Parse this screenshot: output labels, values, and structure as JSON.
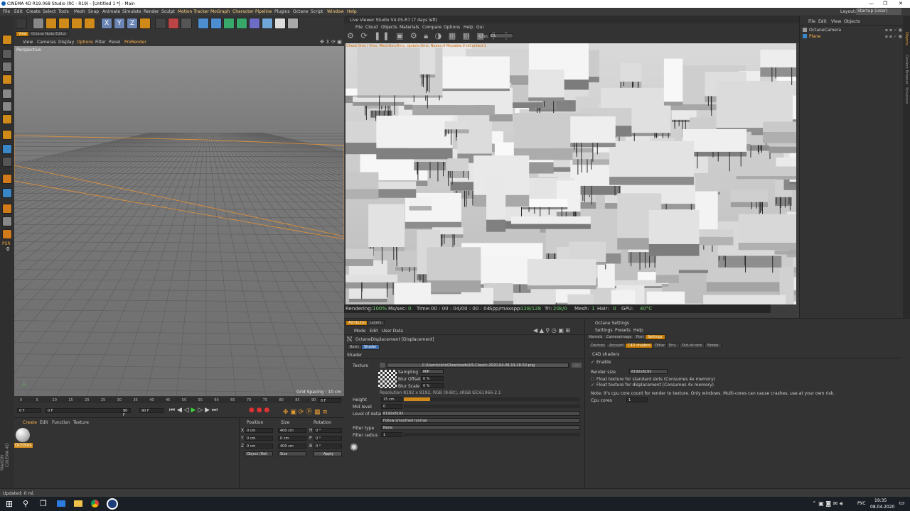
{
  "window": {
    "title": "CINEMA 4D R19.068 Studio (RC - R19) - [Untitled 1 *] - Main",
    "controls": [
      "—",
      "❐",
      "✕"
    ]
  },
  "menubar": {
    "items": [
      "File",
      "Edit",
      "Create",
      "Select",
      "Tools",
      "Mesh",
      "Snap",
      "Animate",
      "Simulate",
      "Render",
      "Sculpt",
      "Motion Tracker",
      "MoGraph",
      "Character",
      "Pipeline",
      "Plugins",
      "Octane",
      "Script",
      "Window",
      "Help"
    ],
    "layout_label": "Layout:",
    "layout_value": "Startup (User)"
  },
  "viewport": {
    "menu": [
      "View",
      "Cameras",
      "Display",
      "Options",
      "Filter",
      "Panel",
      "ProRender"
    ],
    "tab": "Octane Node Editor",
    "label": "Perspective",
    "grid_spacing": "Grid Spacing : 10 cm"
  },
  "timeline": {
    "ticks": [
      "0",
      "5",
      "10",
      "15",
      "20",
      "25",
      "30",
      "35",
      "40",
      "45",
      "50",
      "55",
      "60",
      "65",
      "70",
      "75",
      "80",
      "85",
      "90"
    ],
    "end_frame": "0 F",
    "start_field": "0 F",
    "current_field": "0 F",
    "max_field": "90 F",
    "end_field": "90 F"
  },
  "material_manager": {
    "menu": [
      "Create",
      "Edit",
      "Function",
      "Texture"
    ],
    "material_name": "OctGlos"
  },
  "coordinates": {
    "headers": [
      "Position",
      "Size",
      "Rotation"
    ],
    "rows": [
      {
        "axis": "X",
        "pos": "0 cm",
        "size": "400 cm",
        "rot_axis": "H",
        "rot": "0 °"
      },
      {
        "axis": "Y",
        "pos": "0 cm",
        "size": "0 cm",
        "rot_axis": "P",
        "rot": "0 °"
      },
      {
        "axis": "Z",
        "pos": "0 cm",
        "size": "400 cm",
        "rot_axis": "B",
        "rot": "0 °"
      }
    ],
    "mode": "Object (Rel)",
    "size_mode": "Size",
    "apply": "Apply"
  },
  "live_viewer": {
    "title": "Live Viewer Studio V4.05-R7 (7 days left)",
    "menu": [
      "File",
      "Cloud",
      "Objects",
      "Materials",
      "Compare",
      "Options",
      "Help",
      "Gui"
    ],
    "channel_label": "Chn:",
    "channel_value": "DL",
    "check_line": "Check 0ms / 0ms, MeshGen:0ms, Update:0ms, Nodes:0 Movable:0 txCached:1",
    "status": {
      "rendering_label": "Rendering:",
      "rendering_value": "100%",
      "mssec_label": "Ms/sec:",
      "mssec_value": "0",
      "time_label": "Time:",
      "time_value": "00 : 00 : 04/00 : 00 : 04",
      "spp_label": "Spp/maxspp:",
      "spp_value": "128/128",
      "tri_label": "Tri:",
      "tri_value": "20k/0",
      "mesh_label": "Mesh:",
      "mesh_value": "1",
      "hair_label": "Hair:",
      "hair_value": "0",
      "gpu_label": "GPU:",
      "gpu_value": "40°C"
    }
  },
  "objects_panel": {
    "menu": [
      "File",
      "Edit",
      "View",
      "Objects"
    ],
    "items": [
      {
        "name": "OctaneCamera",
        "color": "#cfcfcf"
      },
      {
        "name": "Plane",
        "color": "#ffb34d"
      }
    ]
  },
  "right_strip_tabs": [
    "Objects",
    "Content Browser",
    "Structure"
  ],
  "attributes": {
    "tabs": [
      "Attributes",
      "Layers"
    ],
    "menu": [
      "Mode",
      "Edit",
      "User Data"
    ],
    "object_name": "OctaneDisplacement [Displacement]",
    "subtabs": [
      "Basic",
      "Shader"
    ],
    "section": "Shader",
    "texture_label": "Texture",
    "texture_path": "C:\\Users\\nicto\\Downloads\\US-Classic-2020-04-08-19-28-50.png",
    "sampling_label": "Sampling",
    "sampling_value": "MIP",
    "blur_offset_label": "Blur Offset",
    "blur_offset_value": "0 %",
    "blur_scale_label": "Blur Scale",
    "blur_scale_value": "0 %",
    "resolution": "Resolution 8192 x 8192, RGB (8-Bit), sRGB IEC61966-2.1",
    "height_label": "Height",
    "height_value": "15 cm",
    "midlevel_label": "Mid level",
    "midlevel_value": "0",
    "lod_label": "Level of detail",
    "lod_value": "8192x8192",
    "smooth_value": "Follow smoothed normal",
    "filter_type_label": "Filter type",
    "filter_type_value": "None",
    "filter_radius_label": "Filter radius",
    "filter_radius_value": "1"
  },
  "octane_settings": {
    "title": "Octane Settings",
    "menu": [
      "Settings",
      "Presets",
      "Help"
    ],
    "tabs": [
      "Kernels",
      "CameraImage",
      "Post",
      "Settings"
    ],
    "subtabs": [
      "Devices",
      "Account",
      "C4D shaders",
      "Other",
      "Env.",
      "Out-of-core",
      "Nodes"
    ],
    "section": "C4D shaders",
    "enable": "Enable",
    "render_size_label": "Render size",
    "render_size_value": "8192x8192",
    "float_standard": "Float texture for standard slots (Consumes 4x memory)",
    "float_displacement": "Float texture for displacement (Consumes 4x memory)",
    "note": "Note: It's cpu core count for render to texture. Only windows. Multi-cores can cause crashes, use at your own risk.",
    "cpu_label": "Cpu cores",
    "cpu_value": "1"
  },
  "statusbar": {
    "text": "Updated: 0 ml."
  },
  "taskbar": {
    "lang": "РУС",
    "time": "19:35",
    "date": "08.04.2020"
  },
  "brand": {
    "maxon": "MAXON",
    "cinema": "CINEMA 4D"
  },
  "left_tools": {
    "psr_label": "PSR",
    "psr_value": "0"
  }
}
